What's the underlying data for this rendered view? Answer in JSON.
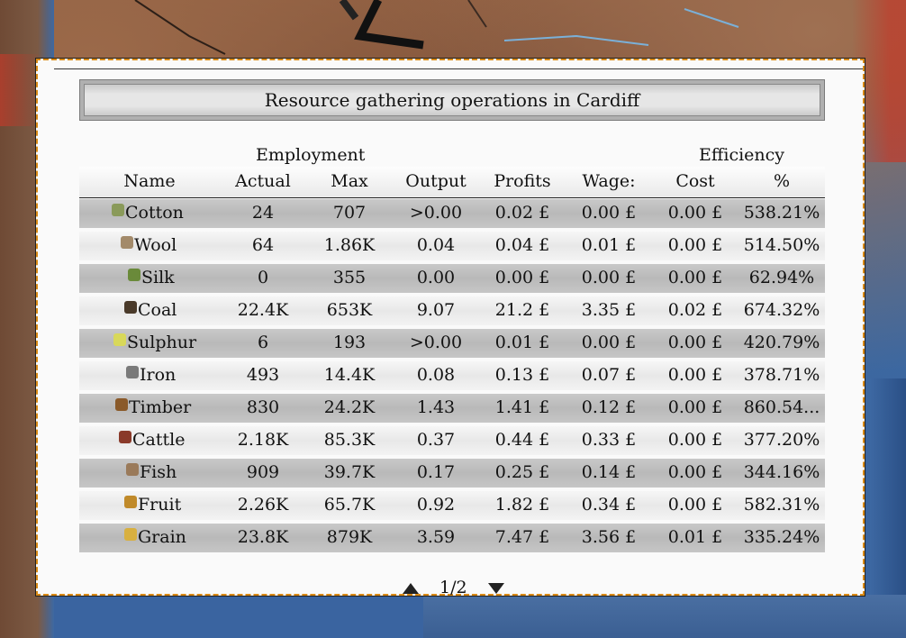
{
  "window": {
    "title": "Resource gathering operations in Cardiff"
  },
  "groups": {
    "employment": "Employment",
    "efficiency": "Efficiency"
  },
  "columns": {
    "name": "Name",
    "actual": "Actual",
    "max": "Max",
    "output": "Output",
    "profits": "Profits",
    "wage": "Wage:",
    "cost": "Cost",
    "percent": "%"
  },
  "rows": [
    {
      "name": "Cotton",
      "icon": "cotton-icon",
      "icon_color": "#8a9a5a",
      "actual": "24",
      "max": "707",
      "output": ">0.00",
      "profits": "0.02 £",
      "wage": "0.00 £",
      "cost": "0.00 £",
      "percent": "538.21%"
    },
    {
      "name": "Wool",
      "icon": "wool-icon",
      "icon_color": "#a38a6a",
      "actual": "64",
      "max": "1.86K",
      "output": "0.04",
      "profits": "0.04 £",
      "wage": "0.01 £",
      "cost": "0.00 £",
      "percent": "514.50%"
    },
    {
      "name": "Silk",
      "icon": "silk-icon",
      "icon_color": "#6a8a3a",
      "actual": "0",
      "max": "355",
      "output": "0.00",
      "profits": "0.00 £",
      "wage": "0.00 £",
      "cost": "0.00 £",
      "percent": "62.94%"
    },
    {
      "name": "Coal",
      "icon": "coal-icon",
      "icon_color": "#4a3a2a",
      "actual": "22.4K",
      "max": "653K",
      "output": "9.07",
      "profits": "21.2 £",
      "wage": "3.35 £",
      "cost": "0.02 £",
      "percent": "674.32%"
    },
    {
      "name": "Sulphur",
      "icon": "sulphur-icon",
      "icon_color": "#d8d85a",
      "actual": "6",
      "max": "193",
      "output": ">0.00",
      "profits": "0.01 £",
      "wage": "0.00 £",
      "cost": "0.00 £",
      "percent": "420.79%"
    },
    {
      "name": "Iron",
      "icon": "iron-icon",
      "icon_color": "#7a7a7a",
      "actual": "493",
      "max": "14.4K",
      "output": "0.08",
      "profits": "0.13 £",
      "wage": "0.07 £",
      "cost": "0.00 £",
      "percent": "378.71%"
    },
    {
      "name": "Timber",
      "icon": "timber-icon",
      "icon_color": "#8a5a2a",
      "actual": "830",
      "max": "24.2K",
      "output": "1.43",
      "profits": "1.41 £",
      "wage": "0.12 £",
      "cost": "0.00 £",
      "percent": "860.54..."
    },
    {
      "name": "Cattle",
      "icon": "cattle-icon",
      "icon_color": "#8a3a2a",
      "actual": "2.18K",
      "max": "85.3K",
      "output": "0.37",
      "profits": "0.44 £",
      "wage": "0.33 £",
      "cost": "0.00 £",
      "percent": "377.20%"
    },
    {
      "name": "Fish",
      "icon": "fish-icon",
      "icon_color": "#9a7a5a",
      "actual": "909",
      "max": "39.7K",
      "output": "0.17",
      "profits": "0.25 £",
      "wage": "0.14 £",
      "cost": "0.00 £",
      "percent": "344.16%"
    },
    {
      "name": "Fruit",
      "icon": "fruit-icon",
      "icon_color": "#c08a2a",
      "actual": "2.26K",
      "max": "65.7K",
      "output": "0.92",
      "profits": "1.82 £",
      "wage": "0.34 £",
      "cost": "0.00 £",
      "percent": "582.31%"
    },
    {
      "name": "Grain",
      "icon": "grain-icon",
      "icon_color": "#d8b040",
      "actual": "23.8K",
      "max": "879K",
      "output": "3.59",
      "profits": "7.47 £",
      "wage": "3.56 £",
      "cost": "0.01 £",
      "percent": "335.24%"
    }
  ],
  "pager": {
    "page": "1/2"
  }
}
